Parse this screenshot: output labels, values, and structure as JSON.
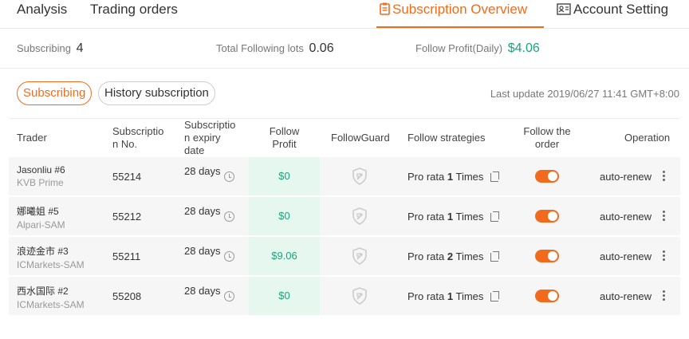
{
  "nav": {
    "analysis": "Analysis",
    "trading_orders": "Trading orders",
    "subscription_overview": "Subscription Overview",
    "account_setting": "Account Setting"
  },
  "summary": {
    "subscribing_label": "Subscribing",
    "subscribing_value": "4",
    "lots_label": "Total Following lots",
    "lots_value": "0.06",
    "profit_label": "Follow Profit(Daily)",
    "profit_value": "$4.06"
  },
  "filters": {
    "subscribing": "Subscribing",
    "history": "History subscription"
  },
  "last_update": "Last update 2019/06/27 11:41 GMT+8:00",
  "table": {
    "headers": {
      "trader": "Trader",
      "sub_no_1": "Subscriptio",
      "sub_no_2": "n No.",
      "expiry_1": "Subscriptio",
      "expiry_2": "n expiry",
      "expiry_3": "date",
      "profit_1": "Follow",
      "profit_2": "Profit",
      "guard": "FollowGuard",
      "strategies": "Follow strategies",
      "follow_1": "Follow the",
      "follow_2": "order",
      "operation": "Operation"
    },
    "rows": [
      {
        "name": "Jasonliu #6",
        "broker": "KVB Prime",
        "sub_no": "55214",
        "expiry": "28 days",
        "profit": "$0",
        "strat_prefix": "Pro rata",
        "strat_mult": "1",
        "strat_suffix": "Times",
        "operation": "auto-renew",
        "follow_on": true
      },
      {
        "name": "娜曦姐 #5",
        "broker": "Alpari-SAM",
        "sub_no": "55212",
        "expiry": "28 days",
        "profit": "$0",
        "strat_prefix": "Pro rata",
        "strat_mult": "1",
        "strat_suffix": "Times",
        "operation": "auto-renew",
        "follow_on": true
      },
      {
        "name": "浪迹金市 #3",
        "broker": "ICMarkets-SAM",
        "sub_no": "55211",
        "expiry": "28 days",
        "profit": "$9.06",
        "strat_prefix": "Pro rata",
        "strat_mult": "2",
        "strat_suffix": "Times",
        "operation": "auto-renew",
        "follow_on": true
      },
      {
        "name": "西水国际 #2",
        "broker": "ICMarkets-SAM",
        "sub_no": "55208",
        "expiry": "28 days",
        "profit": "$0",
        "strat_prefix": "Pro rata",
        "strat_mult": "1",
        "strat_suffix": "Times",
        "operation": "auto-renew",
        "follow_on": true
      }
    ]
  },
  "colors": {
    "accent": "#f26b1d",
    "profit_green": "#1aa37a",
    "profit_bg": "#e6f7f0"
  }
}
